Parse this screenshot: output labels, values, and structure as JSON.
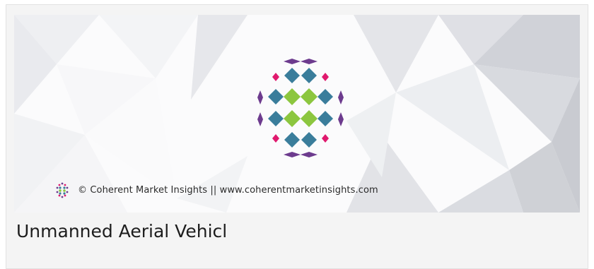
{
  "banner": {
    "watermark_text": "© Coherent Market Insights || www.coherentmarketinsights.com",
    "logo_icon": "coherent-market-insights-logo",
    "colors": {
      "purple": "#6d3b8e",
      "pink": "#e0196e",
      "teal": "#3a7d9b",
      "green": "#8cc63f"
    }
  },
  "card": {
    "title": "Unmanned Aerial Vehicl"
  }
}
